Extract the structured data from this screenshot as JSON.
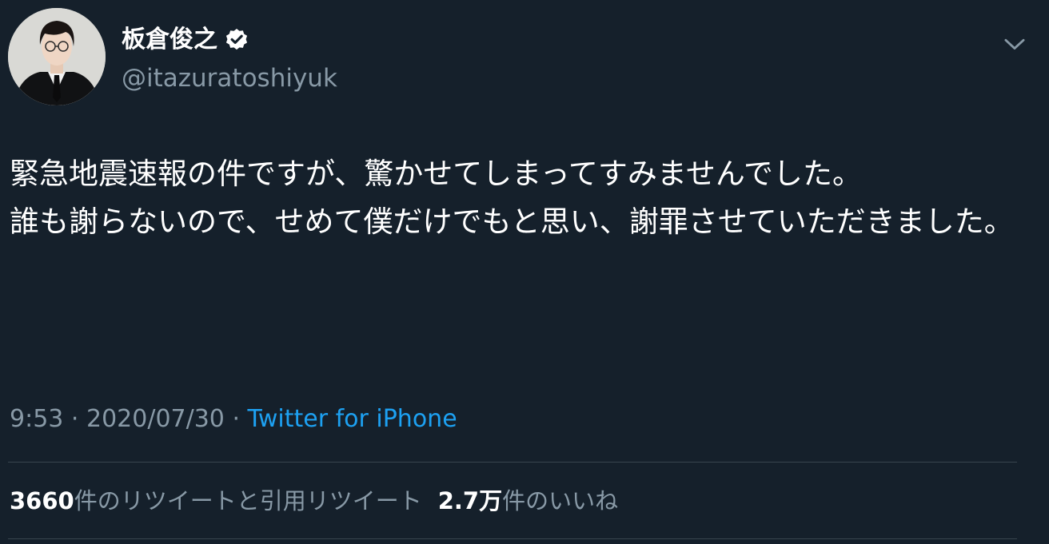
{
  "tweet": {
    "author": {
      "display_name": "板倉俊之",
      "handle": "@itazuratoshiyuk",
      "verified_icon": "verified-badge-icon"
    },
    "menu_icon": "chevron-down-icon",
    "text": "緊急地震速報の件ですが、驚かせてしまってすみませんでした。\n誰も謝らないので、せめて僕だけでもと思い、謝罪させていただきました。",
    "time": "9:53",
    "separator": " · ",
    "date": "2020/07/30",
    "source": "Twitter for iPhone",
    "stats": {
      "retweet_count": "3660",
      "retweet_label": "件のリツイートと引用リツイート",
      "like_count": "2.7万",
      "like_label": "件のいいね"
    }
  },
  "colors": {
    "background": "#15202b",
    "primary_text": "#ffffff",
    "secondary_text": "#8899a6",
    "link": "#1da1f2",
    "divider": "#38444d"
  }
}
